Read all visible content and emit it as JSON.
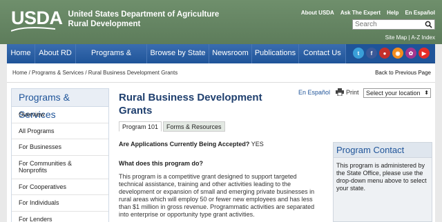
{
  "header": {
    "logo_text": "USDA",
    "agency_line1": "United States Department of Agriculture",
    "agency_line2": "Rural Development",
    "top_links": [
      "About USDA",
      "Ask The Expert",
      "Help",
      "En Español"
    ],
    "search_placeholder": "Search",
    "site_links": [
      "Site Map",
      "|",
      "A-Z Index"
    ]
  },
  "nav": {
    "items": [
      "Home",
      "About RD",
      "Programs & Services",
      "Browse by State",
      "Newsroom",
      "Publications",
      "Contact Us"
    ],
    "social_icons": [
      "twitter-icon",
      "facebook-icon",
      "flickr-icon",
      "rss-icon",
      "blog-icon",
      "youtube-icon"
    ],
    "social_colors": [
      "#3a9fd8",
      "#3b5998",
      "#c4302b",
      "#f28c1e",
      "#a4358e",
      "#e52d27"
    ]
  },
  "breadcrumb": {
    "path": "Home / Programs & Services / Rural Business Development Grants",
    "back_link": "Back to Previous Page"
  },
  "sidebar": {
    "title": "Programs & Services",
    "items": [
      "Overview",
      "All Programs",
      "For Businesses",
      "For Communities & Nonprofits",
      "For Cooperatives",
      "For Individuals",
      "For Lenders"
    ]
  },
  "main": {
    "title": "Rural Business Development Grants",
    "lang_link": "En Español",
    "print_label": "Print",
    "location_select": "Select your location",
    "tabs": [
      "Program 101",
      "Forms & Resources"
    ],
    "question_label": "Are Applications Currently Being Accepted?",
    "question_answer": "YES",
    "section_heading": "What does this program do?",
    "body": "This program is a competitive grant designed to support targeted technical assistance, training and other activities leading to the development or expansion of small and emerging private businesses in rural areas which will employ 50 or fewer new employees and has less than $1 million in gross revenue. Programmatic activities are separated into enterprise or opportunity type grant activities."
  },
  "contact": {
    "title": "Program Contact",
    "body": "This program is administered by the State Office, please use the drop-down menu above to select your state."
  },
  "colors": {
    "header_green": "#6f8f6c",
    "nav_blue": "#1f5499",
    "title_blue": "#1f3f6e"
  }
}
